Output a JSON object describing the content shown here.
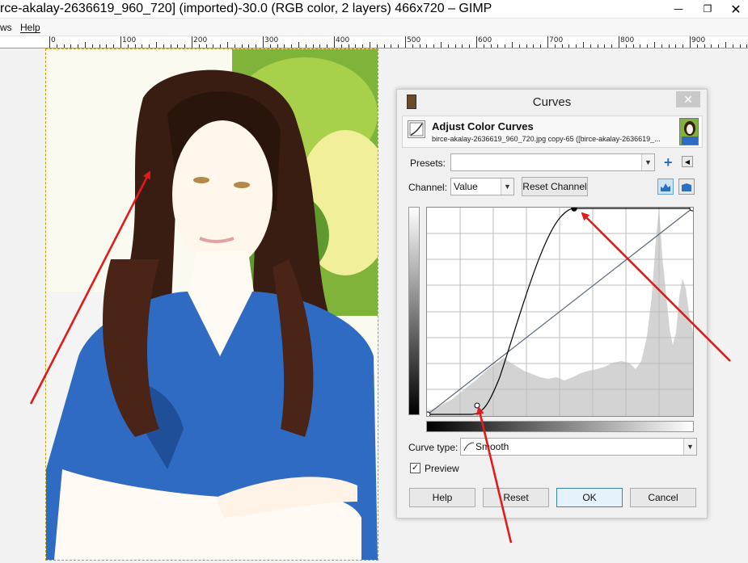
{
  "window": {
    "title": "rce-akalay-2636619_960_720] (imported)-30.0 (RGB color, 2 layers) 466x720 – GIMP",
    "minimize_glyph": "—",
    "maximize_glyph": "❐",
    "close_glyph": "✕"
  },
  "menubar": {
    "items": [
      "ws",
      "Help"
    ]
  },
  "ruler": {
    "labels": [
      "0",
      "100",
      "200",
      "300",
      "400",
      "500",
      "600",
      "700",
      "800",
      "900"
    ]
  },
  "dialog": {
    "title": "Curves",
    "close_glyph": "✕",
    "header_title": "Adjust Color Curves",
    "header_subtitle": "birce-akalay-2636619_960_720.jpg copy-65 ([birce-akalay-2636619_...",
    "presets_label": "Presets:",
    "presets_value": "",
    "channel_label": "Channel:",
    "channel_value": "Value",
    "reset_channel_label": "Reset Channel",
    "curve_type_label": "Curve type:",
    "curve_type_value": "Smooth",
    "preview_label": "Preview",
    "preview_checked": true,
    "buttons": {
      "help": "Help",
      "reset": "Reset",
      "ok": "OK",
      "cancel": "Cancel"
    }
  },
  "colors": {
    "arrow": "#e11a1a",
    "curve": "#000000",
    "diagonal": "#5a6a7a",
    "histogram": "#d5d5d5",
    "grid": "#bdbdbd"
  },
  "icons": {
    "app_icon": "gimp-curves-icon",
    "add_preset": "plus-icon",
    "preset_menu": "triangle-left-icon",
    "linear_histogram": "linear-histogram-icon",
    "log_histogram": "logarithmic-histogram-icon",
    "curve_type": "smooth-curve-icon"
  }
}
